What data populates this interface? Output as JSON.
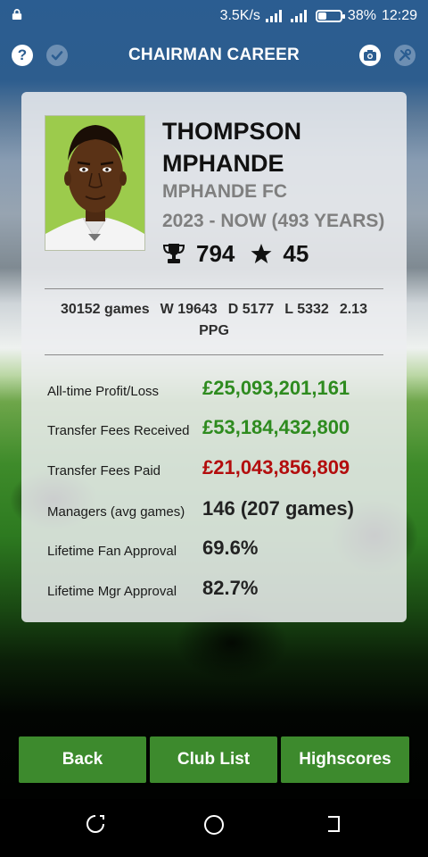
{
  "status_bar": {
    "network_speed": "3.5K/s",
    "battery_percent": "38%",
    "battery_level": 0.38,
    "time": "12:29"
  },
  "app_bar": {
    "title": "CHAIRMAN CAREER",
    "icons": [
      "help-icon",
      "check-icon",
      "camera-icon",
      "settings-icon"
    ]
  },
  "profile": {
    "first_name": "THOMPSON",
    "last_name": "MPHANDE",
    "club": "MPHANDE FC",
    "tenure": "2023 - NOW (493 YEARS)",
    "trophies": "794",
    "stars": "45"
  },
  "record": {
    "games": "30152 games",
    "wins": "W 19643",
    "draws": "D 5177",
    "losses": "L 5332",
    "ppg_value": "2.13",
    "ppg_unit": "PPG"
  },
  "stats": [
    {
      "label": "All-time Profit/Loss",
      "value": "£25,093,201,161",
      "color": "#2e8b1f"
    },
    {
      "label": "Transfer Fees Received",
      "value": "£53,184,432,800",
      "color": "#2e8b1f"
    },
    {
      "label": "Transfer Fees Paid",
      "value": "£21,043,856,809",
      "color": "#b30d0d"
    },
    {
      "label": "Managers (avg games)",
      "value": "146 (207 games)",
      "color": "#222222"
    },
    {
      "label": "Lifetime Fan Approval",
      "value": "69.6%",
      "color": "#222222"
    },
    {
      "label": "Lifetime Mgr Approval",
      "value": "82.7%",
      "color": "#222222"
    }
  ],
  "buttons": {
    "back": "Back",
    "club_list": "Club List",
    "highscores": "Highscores"
  },
  "colors": {
    "button_green": "#3d8a2d",
    "positive": "#2e8b1f",
    "negative": "#b30d0d"
  }
}
